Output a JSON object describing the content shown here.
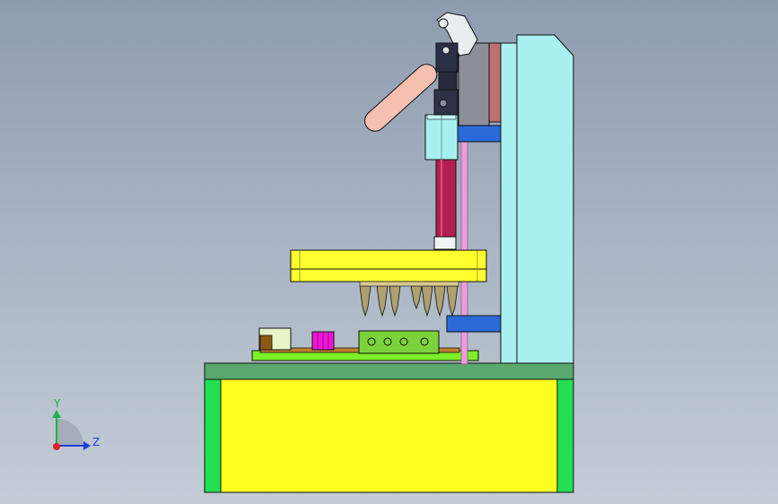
{
  "triad": {
    "y_label": "Y",
    "z_label": "Z",
    "colors": {
      "y": "#21b24a",
      "z": "#1f3fd6",
      "x": "#e02020"
    }
  },
  "colors": {
    "background_top": "#8e9cb0",
    "base_yellow": "#ffff20",
    "base_green": "#22e052",
    "top_plate": "#5aa86e",
    "column": "#a8f0f0",
    "press_plate": "#ffff30",
    "pcb": "#7cf028",
    "rod": "#b41e50",
    "handle": "#f5c0b0",
    "bracket_blue": "#2a6ad8",
    "nozzle": "#b0a070",
    "magenta_part": "#f014d8"
  },
  "icons": {
    "coordinate_triad": "coordinate-triad-icon"
  }
}
